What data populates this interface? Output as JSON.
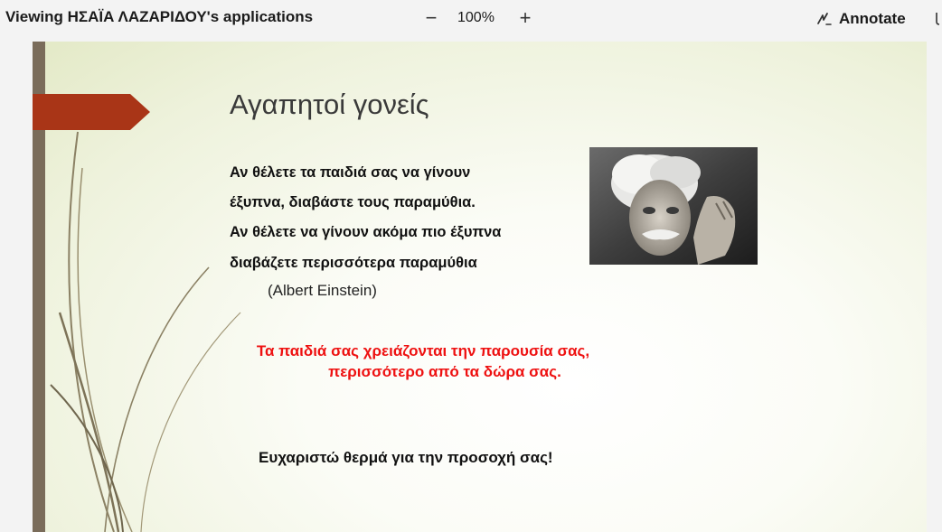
{
  "toolbar": {
    "title": "Viewing ΗΣΑΪΑ ΛΑΖΑΡΙΔΟΥ's applications",
    "zoom_minus": "−",
    "zoom_level": "100%",
    "zoom_plus": "+",
    "annotate_label": "Annotate",
    "annotate_icon": "pen-scribble-icon"
  },
  "slide": {
    "title": "Αγαπητοί γονείς",
    "quote_lines": [
      "Αν θέλετε τα παιδιά σας να γίνουν",
      "έξυπνα, διαβάστε τους παραμύθια.",
      "Αν  θέλετε να γίνουν ακόμα πιο έξυπνα",
      "διαβάζετε περισσότερα παραμύθια"
    ],
    "quote_author": "(Albert Einstein)",
    "highlight_lines": [
      "Τα παιδιά σας χρειάζονται την παρουσία σας,",
      "περισσότερο από τα δώρα σας."
    ],
    "closing": "Ευχαριστώ θερμά για την προσοχή σας!",
    "colors": {
      "accent_arrow": "#a93517",
      "side_bar": "#7a6c5a",
      "highlight_text": "#ee1111"
    }
  }
}
